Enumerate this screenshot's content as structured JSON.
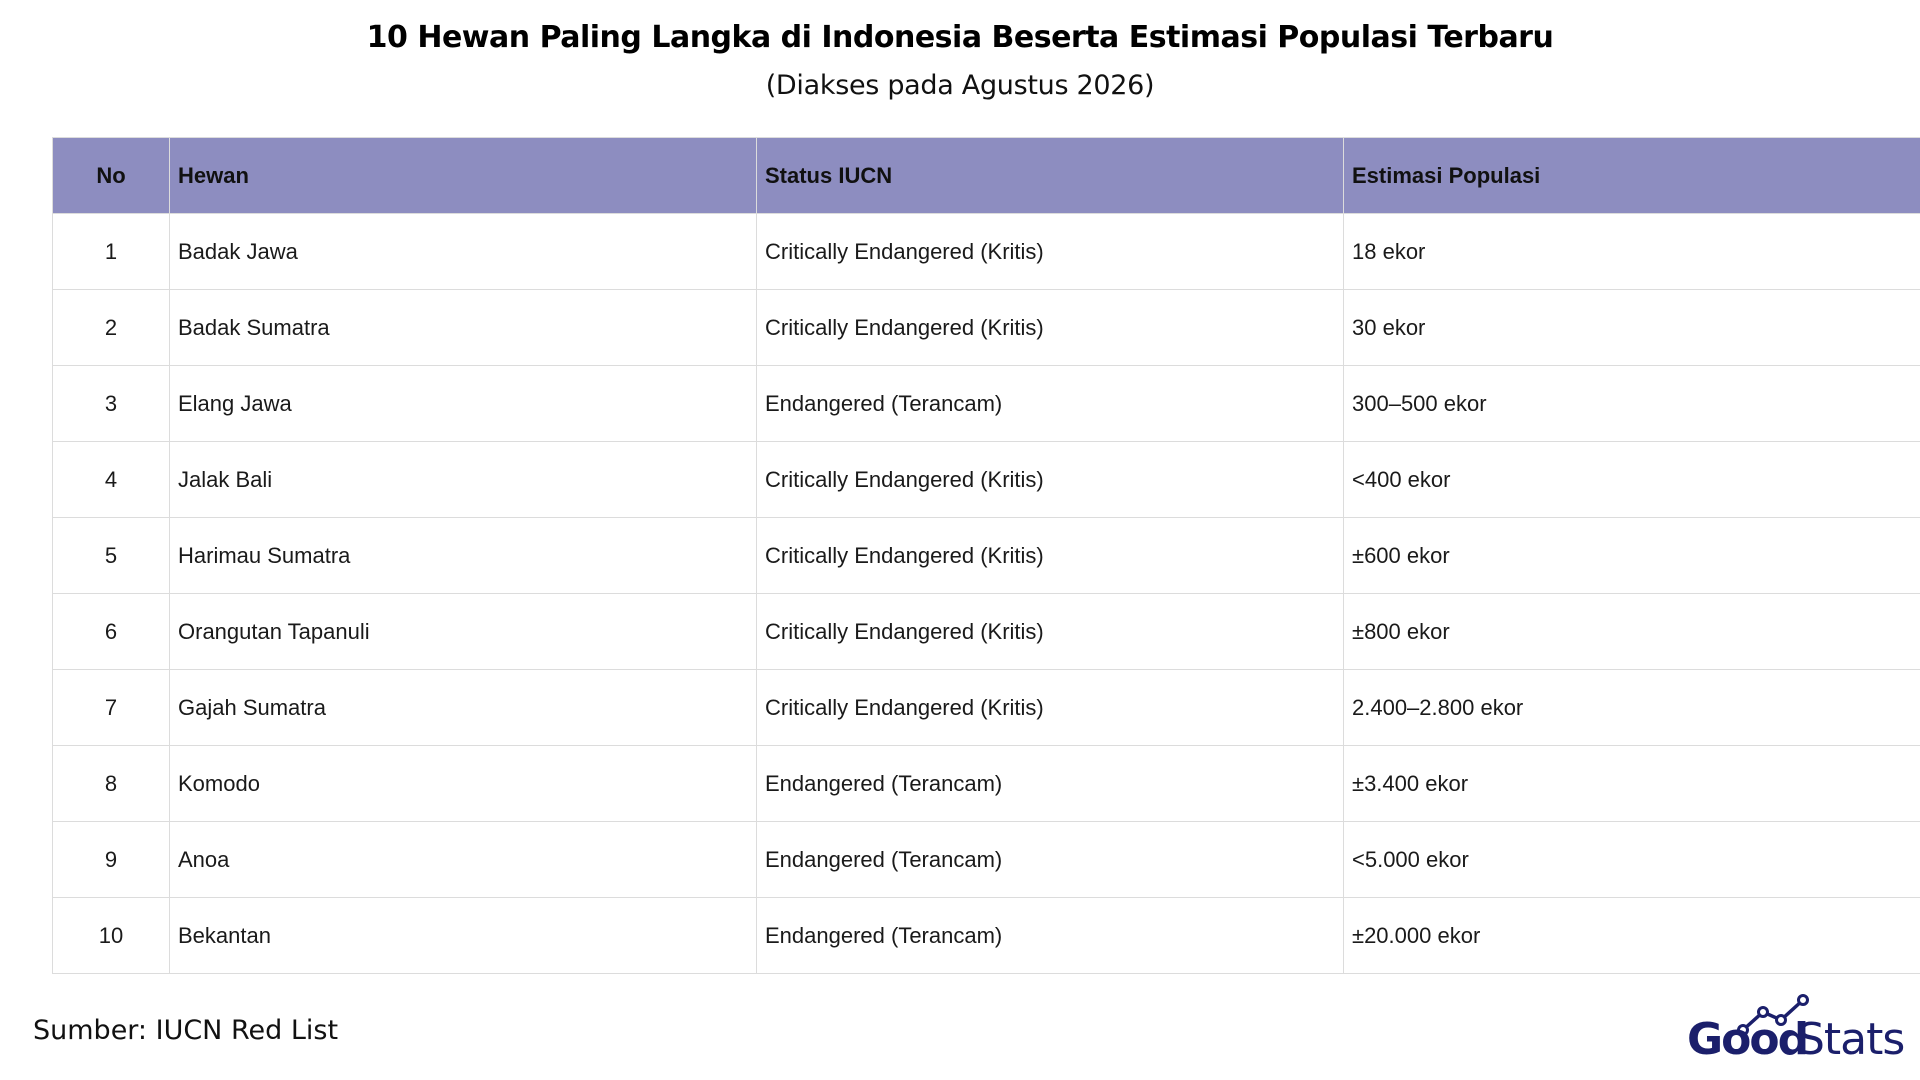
{
  "header": {
    "title": "10 Hewan Paling Langka di Indonesia Beserta Estimasi Populasi Terbaru",
    "subtitle": "(Diakses pada Agustus 2026)"
  },
  "table": {
    "columns": [
      "No",
      "Hewan",
      "Status IUCN",
      "Estimasi Populasi"
    ],
    "rows": [
      {
        "no": "1",
        "animal": "Badak Jawa",
        "status": "Critically Endangered (Kritis)",
        "population": "18 ekor"
      },
      {
        "no": "2",
        "animal": "Badak Sumatra",
        "status": "Critically Endangered (Kritis)",
        "population": "30 ekor"
      },
      {
        "no": "3",
        "animal": "Elang Jawa",
        "status": "Endangered (Terancam)",
        "population": "300–500 ekor"
      },
      {
        "no": "4",
        "animal": "Jalak Bali",
        "status": "Critically Endangered (Kritis)",
        "population": "<400 ekor"
      },
      {
        "no": "5",
        "animal": "Harimau Sumatra",
        "status": "Critically Endangered (Kritis)",
        "population": "±600 ekor"
      },
      {
        "no": "6",
        "animal": "Orangutan Tapanuli",
        "status": "Critically Endangered (Kritis)",
        "population": "±800 ekor"
      },
      {
        "no": "7",
        "animal": "Gajah Sumatra",
        "status": "Critically Endangered (Kritis)",
        "population": "2.400–2.800 ekor"
      },
      {
        "no": "8",
        "animal": "Komodo",
        "status": "Endangered (Terancam)",
        "population": "±3.400 ekor"
      },
      {
        "no": "9",
        "animal": "Anoa",
        "status": "Endangered (Terancam)",
        "population": "<5.000 ekor"
      },
      {
        "no": "10",
        "animal": "Bekantan",
        "status": "Endangered (Terancam)",
        "population": "±20.000 ekor"
      }
    ]
  },
  "footer": {
    "source": "Sumber: IUCN Red List",
    "logo_text_bold": "Good",
    "logo_text_light": "Stats"
  },
  "colors": {
    "header_bg": "#8d8dc0",
    "border": "#dcdcdc",
    "logo_navy": "#1b1f6b"
  }
}
